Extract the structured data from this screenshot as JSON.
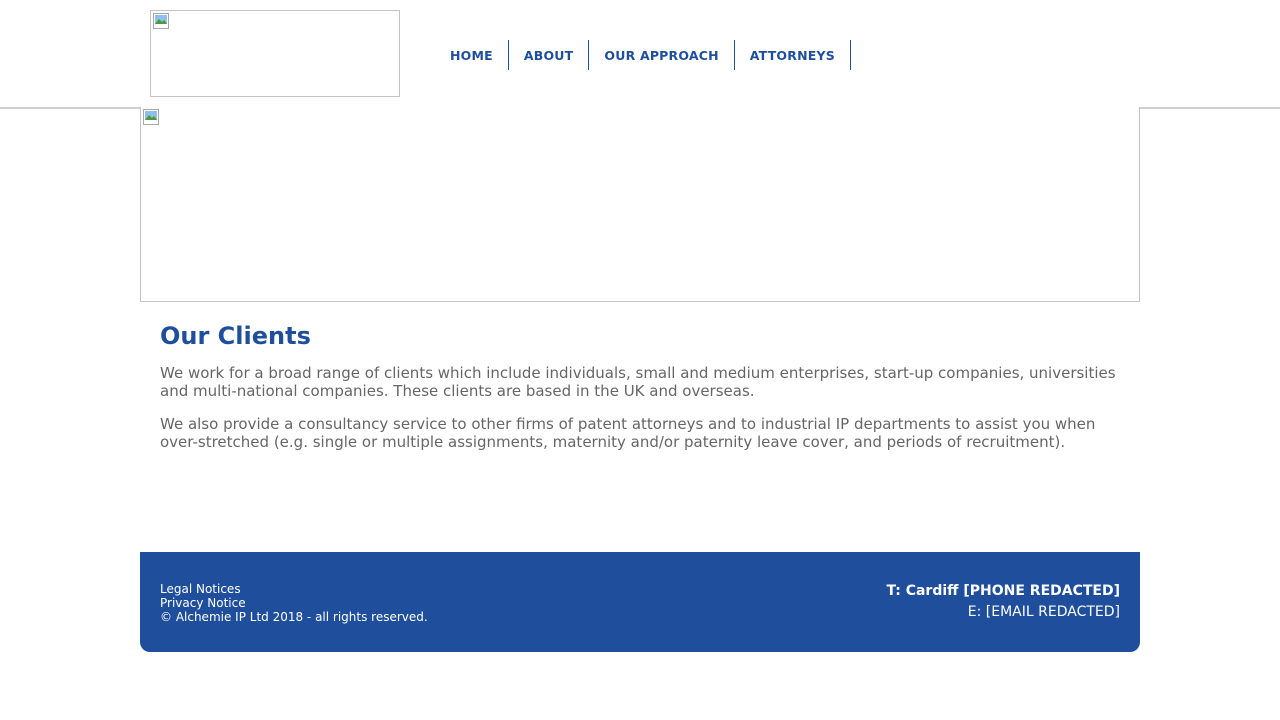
{
  "nav": {
    "items": [
      {
        "label": "HOME"
      },
      {
        "label": "ABOUT"
      },
      {
        "label": "OUR APPROACH"
      },
      {
        "label": "ATTORNEYS"
      }
    ]
  },
  "main": {
    "title": "Our Clients",
    "paragraphs": [
      "We work for a broad range of clients which include individuals, small and medium enterprises, start-up companies, universities and multi-national companies. These clients are based in the UK and overseas.",
      "We also provide a consultancy service to other firms of patent attorneys and to industrial IP departments to assist you when over-stretched (e.g. single or multiple assignments, maternity and/or paternity leave cover, and periods of recruitment)."
    ]
  },
  "footer": {
    "legal_label": "Legal Notices",
    "privacy_label": "Privacy Notice",
    "copyright": "© Alchemie IP Ltd 2018 - all rights reserved.",
    "phone": "T: Cardiff [PHONE REDACTED]",
    "email": "E: [EMAIL REDACTED]"
  },
  "colors": {
    "brand": "#1f4f9c",
    "body_text": "#666666",
    "border": "#c4c4c4"
  },
  "icons": {
    "logo": "broken-image-icon",
    "banner": "broken-image-icon"
  }
}
